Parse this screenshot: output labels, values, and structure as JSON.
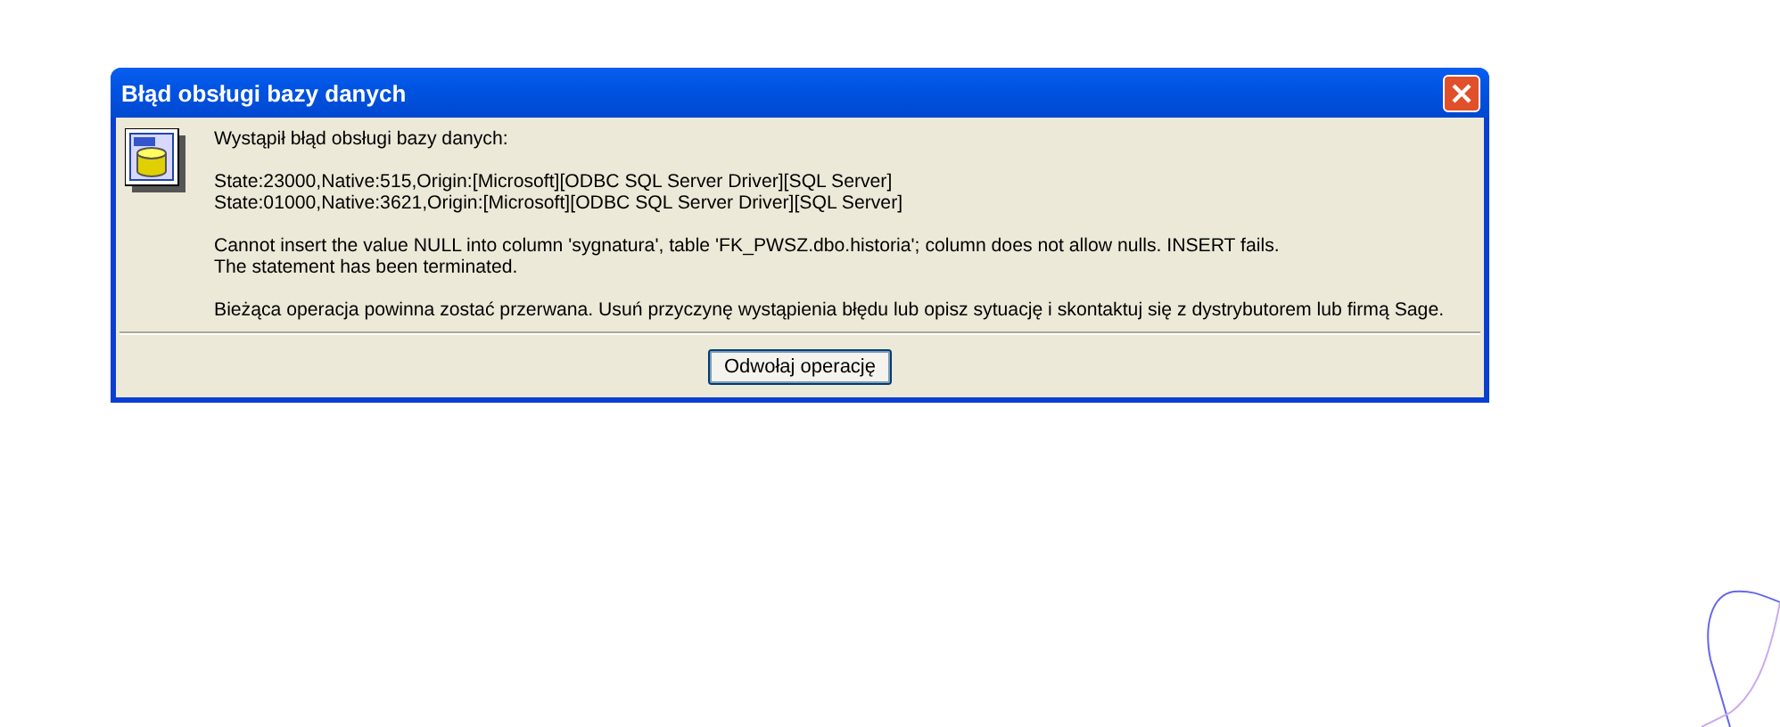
{
  "window": {
    "title": "Błąd obsługi bazy danych"
  },
  "message": {
    "heading": "Wystąpił błąd obsługi bazy danych:",
    "states": [
      "State:23000,Native:515,Origin:[Microsoft][ODBC SQL Server Driver][SQL Server]",
      "State:01000,Native:3621,Origin:[Microsoft][ODBC SQL Server Driver][SQL Server]"
    ],
    "details": [
      "Cannot insert the value NULL into column 'sygnatura', table 'FK_PWSZ.dbo.historia'; column does not allow nulls. INSERT fails.",
      "The statement has been terminated."
    ],
    "advice": "Bieżąca operacja powinna zostać przerwana. Usuń przyczynę wystąpienia błędu lub opisz sytuację i skontaktuj się z dystrybutorem lub firmą Sage."
  },
  "buttons": [
    "Odwołaj operację"
  ]
}
